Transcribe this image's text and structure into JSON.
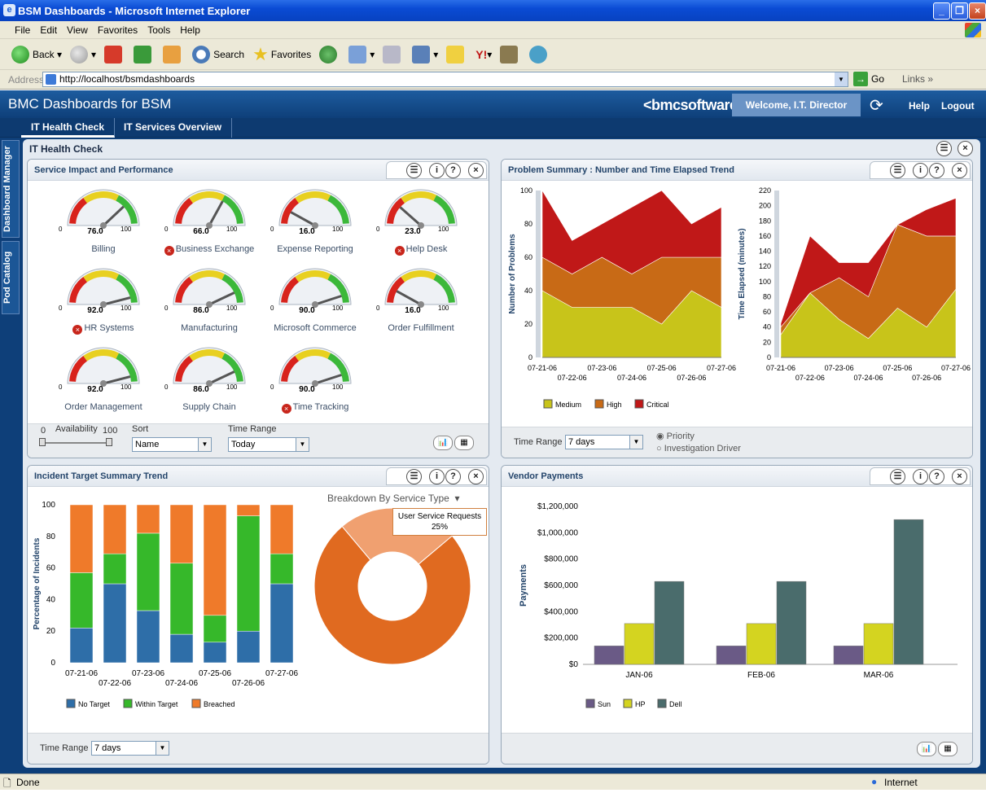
{
  "window": {
    "title": "BSM Dashboards - Microsoft Internet Explorer"
  },
  "menu": [
    "File",
    "Edit",
    "View",
    "Favorites",
    "Tools",
    "Help"
  ],
  "toolbar": {
    "back": "Back",
    "search": "Search",
    "favorites": "Favorites"
  },
  "address": {
    "label": "Address",
    "url": "http://localhost/bsmdashboards",
    "go": "Go",
    "links": "Links"
  },
  "app": {
    "title": "BMC Dashboards for BSM",
    "logo": "bmcsoftware",
    "welcome": "Welcome, I.T. Director",
    "help": "Help",
    "logout": "Logout",
    "tabs": [
      "IT Health Check",
      "IT Services Overview"
    ],
    "side_tabs": [
      "Dashboard Manager",
      "Pod Catalog"
    ],
    "page_title": "IT Health Check"
  },
  "service_impact": {
    "title": "Service Impact and Performance",
    "gauges": [
      {
        "label": "Billing",
        "value": "76.0",
        "alert": false,
        "v": 76
      },
      {
        "label": "Business Exchange",
        "value": "66.0",
        "alert": true,
        "v": 66
      },
      {
        "label": "Expense Reporting",
        "value": "16.0",
        "alert": false,
        "v": 16
      },
      {
        "label": "Help Desk",
        "value": "23.0",
        "alert": true,
        "v": 23
      },
      {
        "label": "HR Systems",
        "value": "92.0",
        "alert": true,
        "v": 92
      },
      {
        "label": "Manufacturing",
        "value": "86.0",
        "alert": false,
        "v": 86
      },
      {
        "label": "Microsoft Commerce",
        "value": "90.0",
        "alert": false,
        "v": 90
      },
      {
        "label": "Order Fulfillment",
        "value": "16.0",
        "alert": false,
        "v": 16
      },
      {
        "label": "Order Management",
        "value": "92.0",
        "alert": false,
        "v": 92
      },
      {
        "label": "Supply Chain",
        "value": "86.0",
        "alert": false,
        "v": 86
      },
      {
        "label": "Time Tracking",
        "value": "90.0",
        "alert": true,
        "v": 90
      }
    ],
    "gauge_min": "0",
    "gauge_max": "100",
    "availability_label": "Availability",
    "availability_min": "0",
    "availability_max": "100",
    "sort_label": "Sort",
    "sort_value": "Name",
    "time_range_label": "Time Range",
    "time_range_value": "Today"
  },
  "problem_summary": {
    "title": "Problem Summary : Number and Time Elapsed Trend",
    "time_range_label": "Time Range",
    "time_range_value": "7 days",
    "radio_priority": "Priority",
    "radio_driver": "Investigation Driver"
  },
  "incident": {
    "title": "Incident Target Summary Trend",
    "breakdown_label": "Breakdown By Service Type",
    "tooltip_line1": "User Service Requests",
    "tooltip_line2": "25%",
    "time_range_label": "Time Range",
    "time_range_value": "7 days"
  },
  "vendor": {
    "title": "Vendor Payments"
  },
  "status": {
    "left": "Done",
    "right": "Internet"
  },
  "chart_data": [
    {
      "type": "area",
      "title": "",
      "ylabel": "Number of Problems",
      "x": [
        "07-21-06",
        "07-22-06",
        "07-23-06",
        "07-24-06",
        "07-25-06",
        "07-26-06",
        "07-27-06"
      ],
      "ylim": [
        0,
        100
      ],
      "yticks": [
        "0",
        "20",
        "40",
        "60",
        "80",
        "100"
      ],
      "stacked": true,
      "series": [
        {
          "name": "Medium",
          "color": "#c8c41a",
          "values": [
            40,
            30,
            30,
            30,
            20,
            40,
            30
          ]
        },
        {
          "name": "High",
          "color": "#c86a16",
          "values": [
            20,
            20,
            30,
            20,
            40,
            20,
            30
          ]
        },
        {
          "name": "Critical",
          "color": "#c01818",
          "values": [
            40,
            20,
            20,
            40,
            40,
            20,
            30
          ]
        }
      ]
    },
    {
      "type": "area",
      "title": "",
      "ylabel": "Time Elapsed (minutes)",
      "x": [
        "07-21-06",
        "07-22-06",
        "07-23-06",
        "07-24-06",
        "07-25-06",
        "07-26-06",
        "07-27-06"
      ],
      "ylim": [
        0,
        220
      ],
      "yticks": [
        "0",
        "20",
        "40",
        "60",
        "80",
        "100",
        "120",
        "140",
        "160",
        "180",
        "200",
        "220"
      ],
      "stacked": true,
      "series": [
        {
          "name": "Medium",
          "color": "#c8c41a",
          "values": [
            30,
            85,
            50,
            25,
            65,
            40,
            90
          ]
        },
        {
          "name": "High",
          "color": "#c86a16",
          "values": [
            10,
            0,
            55,
            55,
            110,
            120,
            70
          ]
        },
        {
          "name": "Critical",
          "color": "#c01818",
          "values": [
            5,
            75,
            20,
            45,
            0,
            35,
            50
          ]
        }
      ]
    },
    {
      "type": "bar",
      "title": "",
      "ylabel": "Percentage of Incidents",
      "stacked": true,
      "categories": [
        "07-21-06",
        "07-22-06",
        "07-23-06",
        "07-24-06",
        "07-25-06",
        "07-26-06",
        "07-27-06"
      ],
      "ylim": [
        0,
        100
      ],
      "yticks": [
        "0",
        "20",
        "40",
        "60",
        "80",
        "100"
      ],
      "series": [
        {
          "name": "No Target",
          "color": "#2e6ea8",
          "values": [
            22,
            50,
            33,
            18,
            13,
            20,
            50
          ]
        },
        {
          "name": "Within Target",
          "color": "#36b82a",
          "values": [
            35,
            19,
            49,
            45,
            17,
            73,
            19
          ]
        },
        {
          "name": "Breached",
          "color": "#ef7a2a",
          "values": [
            43,
            31,
            18,
            37,
            70,
            7,
            31
          ]
        }
      ]
    },
    {
      "type": "pie",
      "title": "",
      "slices": [
        {
          "name": "User Service Requests",
          "value": 25,
          "color": "#f0a070"
        },
        {
          "name": "",
          "value": 75,
          "color": "#e06a20"
        }
      ]
    },
    {
      "type": "bar",
      "title": "",
      "ylabel": "Payments",
      "categories": [
        "JAN-06",
        "FEB-06",
        "MAR-06"
      ],
      "ylim": [
        0,
        1200000
      ],
      "yticks": [
        "$0",
        "$200,000",
        "$400,000",
        "$600,000",
        "$800,000",
        "$1,000,000",
        "$1,200,000"
      ],
      "series": [
        {
          "name": "Sun",
          "color": "#6a5a86",
          "values": [
            140000,
            140000,
            140000
          ]
        },
        {
          "name": "HP",
          "color": "#d4d420",
          "values": [
            310000,
            310000,
            310000
          ]
        },
        {
          "name": "Dell",
          "color": "#4a6c6c",
          "values": [
            630000,
            630000,
            1100000
          ]
        }
      ]
    }
  ]
}
